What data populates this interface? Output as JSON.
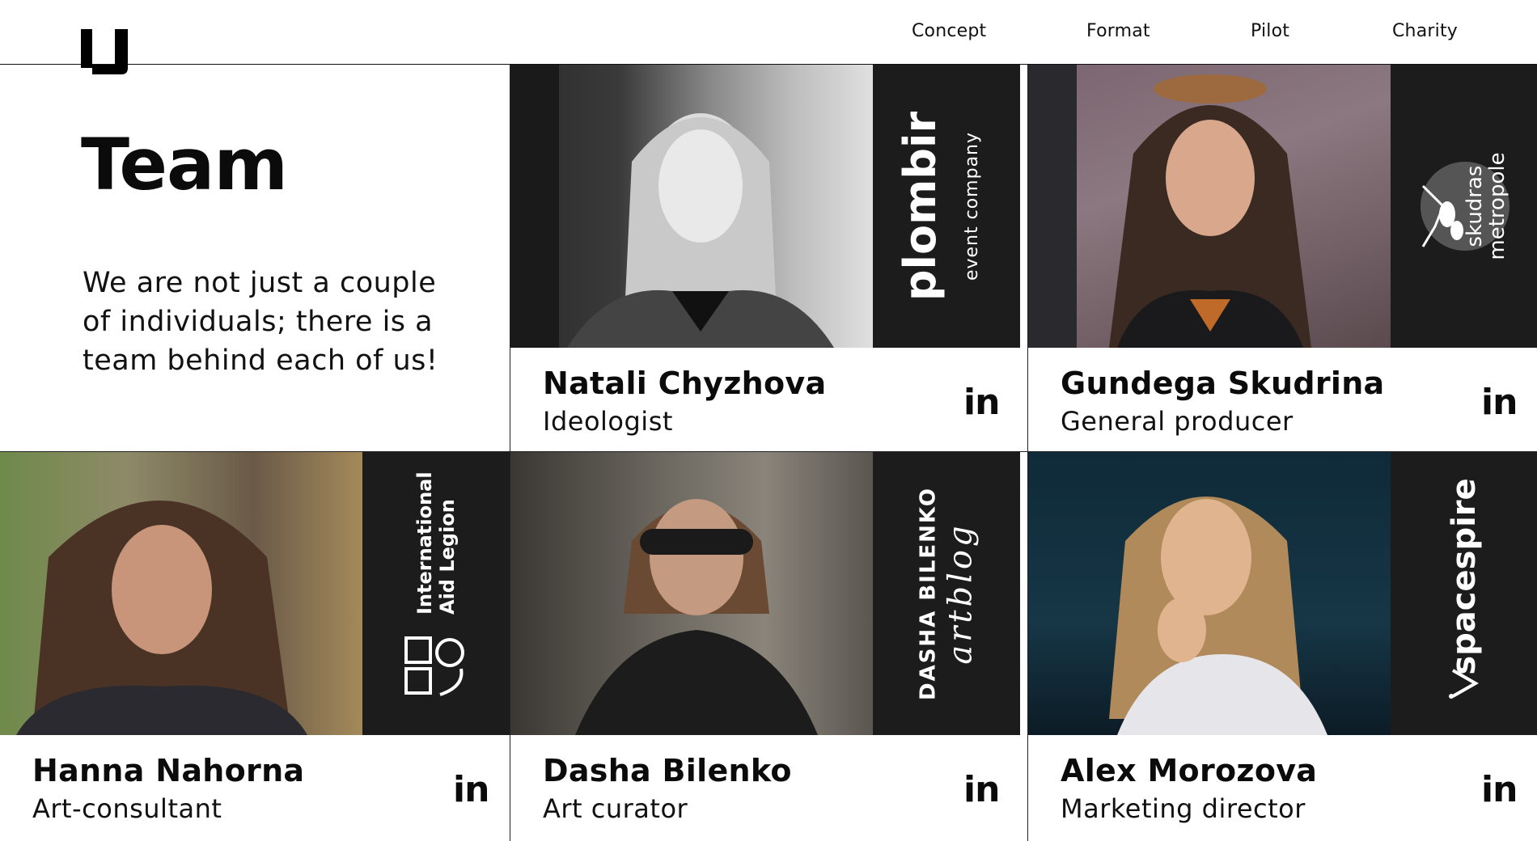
{
  "header": {
    "nav": [
      "Concept",
      "Format",
      "Pilot",
      "Charity"
    ]
  },
  "intro": {
    "title": "Team",
    "text": "We are not just a couple of individuals; there is a team behind each of us!"
  },
  "team": [
    {
      "name": "Natali Chyzhova",
      "role": "Ideologist",
      "brand_line1": "plombir",
      "brand_line2": "event company",
      "linkedin": "in",
      "photo_style": "bw"
    },
    {
      "name": "Gundega Skudrina",
      "role": "General producer",
      "brand_line1": "skudras",
      "brand_line2": "metropole",
      "linkedin": "in",
      "photo_style": "color"
    },
    {
      "name": "Hanna Nahorna",
      "role": "Art-consultant",
      "brand_line1": "International Aid Legion",
      "brand_line2": "",
      "linkedin": "in",
      "photo_style": "color"
    },
    {
      "name": "Dasha Bilenko",
      "role": "Art curator",
      "brand_line1": "DASHA BILENKO",
      "brand_line2": "artblog",
      "linkedin": "in",
      "photo_style": "color"
    },
    {
      "name": "Alex Morozova",
      "role": "Marketing director",
      "brand_line1": "spacespire",
      "brand_line2": "",
      "linkedin": "in",
      "photo_style": "color"
    }
  ],
  "colors": {
    "panel": "#1c1c1c",
    "text": "#0b0b0b",
    "background": "#ffffff"
  }
}
